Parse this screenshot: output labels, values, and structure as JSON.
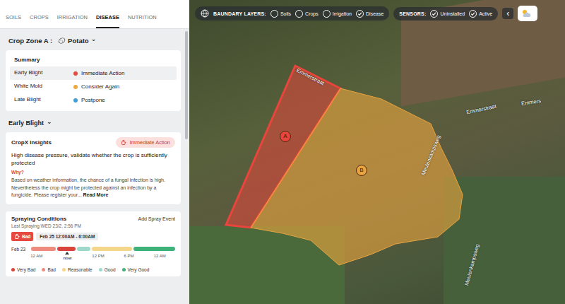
{
  "tabs": [
    {
      "label": "SOILS",
      "selected": false
    },
    {
      "label": "CROPS",
      "selected": false
    },
    {
      "label": "IRRIGATION",
      "selected": false
    },
    {
      "label": "DISEASE",
      "selected": true
    },
    {
      "label": "NUTRITION",
      "selected": false
    }
  ],
  "crop_zone": {
    "label": "Crop Zone A :",
    "crop": "Potato",
    "chevron": "⌄"
  },
  "summary": {
    "title": "Summary",
    "rows": [
      {
        "disease": "Early Blight",
        "action": "Immediate Action",
        "color": "#e5493f",
        "selected": true
      },
      {
        "disease": "White Mold",
        "action": "Consider Again",
        "color": "#eea93a",
        "selected": false
      },
      {
        "disease": "Late Blight",
        "action": "Postpone",
        "color": "#3d9fd6",
        "selected": false
      }
    ]
  },
  "section": {
    "title": "Early Blight",
    "chevron": "⌄"
  },
  "insights": {
    "title": "CropX Insights",
    "badge": "Immediate Action",
    "headline": "High disease pressure, validate whether the crop is sufficiently protected",
    "why": "Why?",
    "body": "Based on weather information, the chance of a fungal infection is high. Nevertheless the crop might be protected against an infection by a fungicide. Please register your...",
    "link": "Read More"
  },
  "spraying": {
    "title": "Spraying Conditions",
    "add": "Add Spray Event",
    "last": "Last Spraying WED 23/2, 2:56 PM",
    "status": "Bad",
    "status_color": "#e5493f",
    "window": "Feb 25 12:00AM - 6:00AM",
    "date": "Feb 23",
    "segments": [
      {
        "status": "Bad",
        "color": "#ee8c7e",
        "level": 0.18
      },
      {
        "status": "Very Bad",
        "color": "#d9453d",
        "level": 0.13
      },
      {
        "status": "Good",
        "color": "#9ed9cc",
        "level": 0.1
      },
      {
        "status": "Reasonable",
        "color": "#f3d68a",
        "level": 0.29
      },
      {
        "status": "Very Good",
        "color": "#3db37a",
        "level": 0.3
      }
    ],
    "ticks": [
      {
        "label": "12 AM",
        "kind": "tick"
      },
      {
        "label": "now",
        "kind": "now"
      },
      {
        "label": "12 PM",
        "kind": "tick"
      },
      {
        "label": "6 PM",
        "kind": "tick"
      },
      {
        "label": "12 AM",
        "kind": "tick"
      }
    ],
    "legend": [
      {
        "label": "Very Bad",
        "color": "#d9453d"
      },
      {
        "label": "Bad",
        "color": "#ee8c7e"
      },
      {
        "label": "Reasonable",
        "color": "#f3d68a"
      },
      {
        "label": "Good",
        "color": "#9ed9cc"
      },
      {
        "label": "Very Good",
        "color": "#3db37a"
      }
    ]
  },
  "scrollbar": {
    "level": 0.4
  },
  "map": {
    "layers_label": "BAUNDARY LAYERS:",
    "layers": [
      {
        "label": "Soils",
        "checked": false
      },
      {
        "label": "Crops",
        "checked": false
      },
      {
        "label": "Irrigation",
        "checked": false
      },
      {
        "label": "Disease",
        "checked": true
      }
    ],
    "sensors_label": "SENSORS:",
    "sensors": [
      {
        "label": "Uninstalled",
        "checked": true
      },
      {
        "label": "Active",
        "checked": true
      }
    ],
    "collapse": "‹",
    "fields": [
      {
        "label": "A",
        "color": "#e8453c",
        "selected": true
      },
      {
        "label": "B",
        "color": "#e9a43f",
        "selected": false
      }
    ],
    "roads": [
      "Emmerstraat",
      "Emmerstraat",
      "Emmers",
      "Meulenkampsweg",
      "Meulenkampsweg"
    ]
  }
}
